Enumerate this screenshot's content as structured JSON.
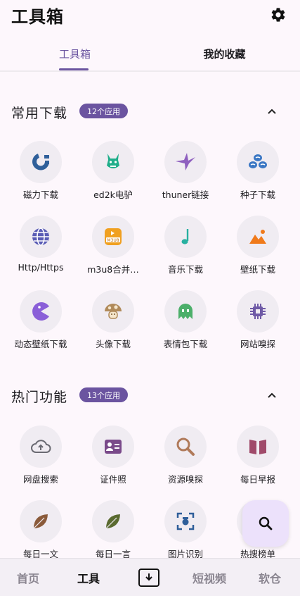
{
  "header": {
    "title": "工具箱",
    "settings_icon": "gear-icon"
  },
  "tabs": [
    {
      "label": "工具箱",
      "active": true
    },
    {
      "label": "我的收藏",
      "active": false
    }
  ],
  "sections": [
    {
      "title": "常用下载",
      "badge": "12个应用",
      "items": [
        {
          "label": "磁力下载",
          "icon": "magnet-icon"
        },
        {
          "label": "ed2k电驴",
          "icon": "donkey-icon"
        },
        {
          "label": "thuner链接",
          "icon": "bird-icon"
        },
        {
          "label": "种子下载",
          "icon": "seeds-icon"
        },
        {
          "label": "Http/Https",
          "icon": "globe-icon"
        },
        {
          "label": "m3u8合并…",
          "icon": "m3u8-icon"
        },
        {
          "label": "音乐下载",
          "icon": "music-note-icon"
        },
        {
          "label": "壁纸下载",
          "icon": "image-icon"
        },
        {
          "label": "动态壁纸下载",
          "icon": "pacman-icon"
        },
        {
          "label": "头像下载",
          "icon": "mushroom-icon"
        },
        {
          "label": "表情包下载",
          "icon": "ghost-icon"
        },
        {
          "label": "网站嗅探",
          "icon": "chip-icon"
        }
      ]
    },
    {
      "title": "热门功能",
      "badge": "13个应用",
      "items": [
        {
          "label": "网盘搜索",
          "icon": "cloud-upload-icon"
        },
        {
          "label": "证件照",
          "icon": "id-card-icon"
        },
        {
          "label": "资源嗅探",
          "icon": "magnifier-icon"
        },
        {
          "label": "每日早报",
          "icon": "book-icon"
        },
        {
          "label": "每日一文",
          "icon": "leaf-brown-icon"
        },
        {
          "label": "每日一言",
          "icon": "leaf-olive-icon"
        },
        {
          "label": "图片识别",
          "icon": "scan-icon"
        },
        {
          "label": "热搜榜单",
          "icon": "trending-icon"
        }
      ]
    }
  ],
  "fab": {
    "icon": "search-icon"
  },
  "bottom_nav": [
    {
      "label": "首页",
      "active": false
    },
    {
      "label": "工具",
      "active": true
    },
    {
      "label": "",
      "icon": "download-icon"
    },
    {
      "label": "短视频",
      "active": false
    },
    {
      "label": "软仓",
      "active": false
    }
  ],
  "colors": {
    "accent": "#6b54a0",
    "background": "#fdf7fc",
    "icon_bg": "#f0ecf2"
  }
}
